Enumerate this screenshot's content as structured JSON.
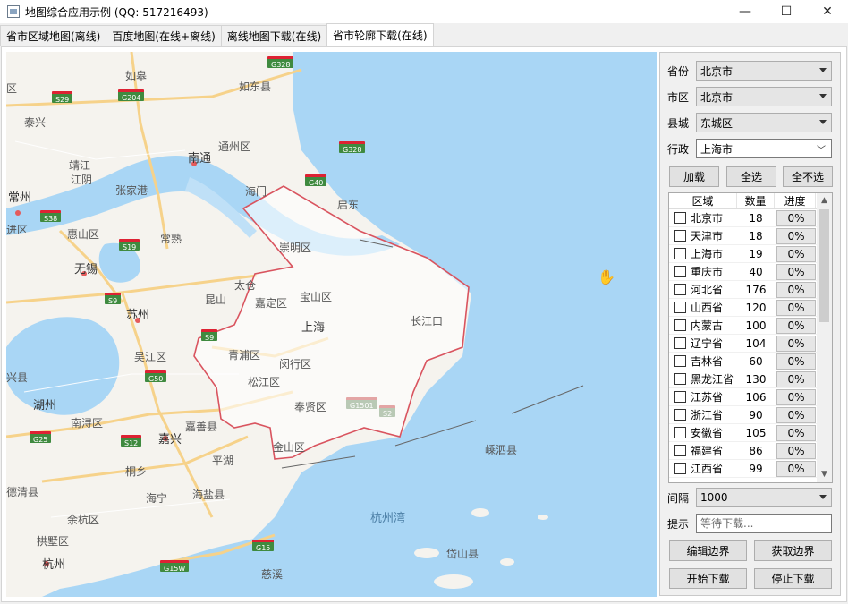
{
  "window": {
    "title": "地图综合应用示例 (QQ: 517216493)",
    "controls": {
      "minimize": "—",
      "maximize": "☐",
      "close": "✕"
    }
  },
  "tabs": [
    {
      "label": "省市区域地图(离线)"
    },
    {
      "label": "百度地图(在线+离线)"
    },
    {
      "label": "离线地图下载(在线)"
    },
    {
      "label": "省市轮廓下载(在线)"
    }
  ],
  "map": {
    "places": [
      "如皋",
      "如东县",
      "泰兴",
      "靖江",
      "江阴",
      "通州区",
      "南通",
      "张家港",
      "海门",
      "启东",
      "常州",
      "惠山区",
      "进区",
      "常熟",
      "无锡",
      "苏州",
      "昆山",
      "太仓",
      "嘉定区",
      "宝山区",
      "上海",
      "长江口",
      "吴江区",
      "青浦区",
      "闵行区",
      "松江区",
      "奉贤区",
      "湖州",
      "南浔区",
      "嘉善县",
      "嘉兴",
      "平湖",
      "金山区",
      "桐乡",
      "海宁",
      "海盐县",
      "德清县",
      "余杭区",
      "拱墅区",
      "杭州",
      "杭州湾",
      "嵊泗县",
      "岱山县",
      "慈溪",
      "崇明区",
      "区",
      "兴县"
    ],
    "highways": [
      "G328",
      "S29",
      "G204",
      "G328",
      "G40",
      "S38",
      "S19",
      "S9",
      "S9",
      "G50",
      "G25",
      "S12",
      "G1501",
      "S2",
      "G15",
      "G15W"
    ]
  },
  "panel": {
    "province": {
      "label": "省份",
      "value": "北京市"
    },
    "city": {
      "label": "市区",
      "value": "北京市"
    },
    "county": {
      "label": "县城",
      "value": "东城区"
    },
    "admin": {
      "label": "行政",
      "value": "上海市"
    },
    "buttons": {
      "load": "加载",
      "select_all": "全选",
      "select_none": "全不选"
    },
    "table": {
      "headers": [
        "区域",
        "数量",
        "进度"
      ],
      "rows": [
        {
          "name": "北京市",
          "count": "18",
          "progress": "0%"
        },
        {
          "name": "天津市",
          "count": "18",
          "progress": "0%"
        },
        {
          "name": "上海市",
          "count": "19",
          "progress": "0%"
        },
        {
          "name": "重庆市",
          "count": "40",
          "progress": "0%"
        },
        {
          "name": "河北省",
          "count": "176",
          "progress": "0%"
        },
        {
          "name": "山西省",
          "count": "120",
          "progress": "0%"
        },
        {
          "name": "内蒙古",
          "count": "100",
          "progress": "0%"
        },
        {
          "name": "辽宁省",
          "count": "104",
          "progress": "0%"
        },
        {
          "name": "吉林省",
          "count": "60",
          "progress": "0%"
        },
        {
          "name": "黑龙江省",
          "count": "130",
          "progress": "0%"
        },
        {
          "name": "江苏省",
          "count": "106",
          "progress": "0%"
        },
        {
          "name": "浙江省",
          "count": "90",
          "progress": "0%"
        },
        {
          "name": "安徽省",
          "count": "105",
          "progress": "0%"
        },
        {
          "name": "福建省",
          "count": "86",
          "progress": "0%"
        },
        {
          "name": "江西省",
          "count": "99",
          "progress": "0%"
        }
      ]
    },
    "interval": {
      "label": "间隔",
      "value": "1000"
    },
    "hint": {
      "label": "提示",
      "placeholder": "等待下载..."
    },
    "actions": {
      "edit_boundary": "编辑边界",
      "get_boundary": "获取边界",
      "start_download": "开始下载",
      "stop_download": "停止下载"
    }
  }
}
